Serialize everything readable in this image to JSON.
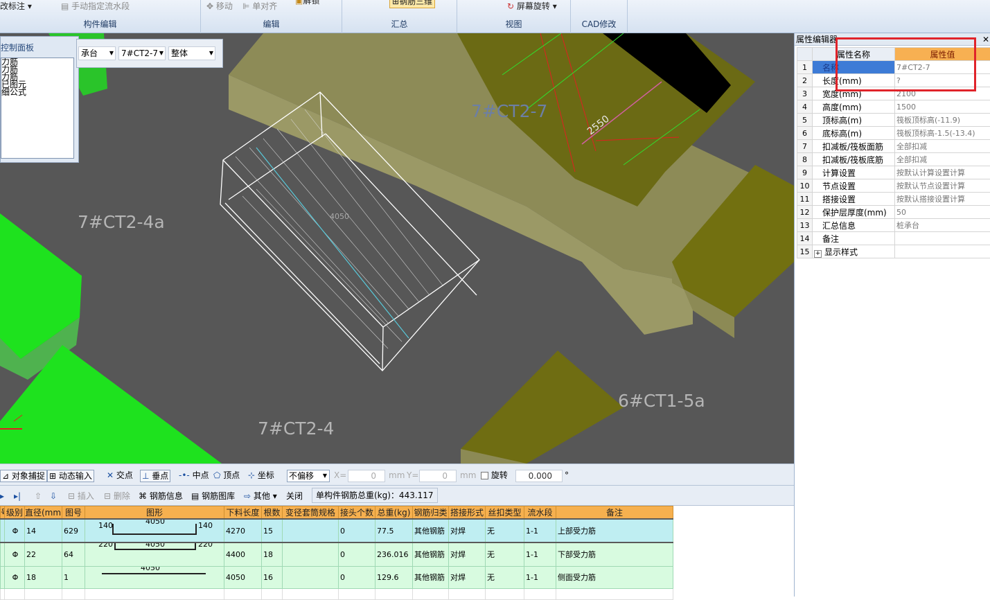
{
  "ribbon": {
    "mark_label": "改标注",
    "manual_flow": "手动指定流水段",
    "group_component": "构件编辑",
    "move": "移动",
    "align": "单对齐",
    "unlock": "解锁",
    "group_edit": "编辑",
    "rebar3d": "钢筋三维",
    "group_summary": "汇总",
    "screen_rotate": "屏幕旋转",
    "group_view": "视图",
    "group_cad": "CAD修改"
  },
  "control_panel": {
    "title": "控制面板",
    "items": [
      "力筋",
      "力筋",
      "力筋",
      "已图元",
      "细公式"
    ]
  },
  "selectors": {
    "type": "承台",
    "name": "7#CT2-7",
    "scope": "整体"
  },
  "viewport": {
    "labels": {
      "ct27": "7#CT2-7",
      "ct24a": "7#CT2-4a",
      "ct24": "7#CT2-4",
      "ct15a": "6#CT1-5a",
      "dim2550": "2550",
      "dim4050": "4050"
    }
  },
  "property_editor": {
    "title": "属性编辑器",
    "col_name": "属性名称",
    "col_value": "属性值",
    "rows": [
      {
        "n": "1",
        "name": "名称",
        "value": "7#CT2-7"
      },
      {
        "n": "2",
        "name": "长度(mm)",
        "value": "?"
      },
      {
        "n": "3",
        "name": "宽度(mm)",
        "value": "2100"
      },
      {
        "n": "4",
        "name": "高度(mm)",
        "value": "1500"
      },
      {
        "n": "5",
        "name": "顶标高(m)",
        "value": "筏板顶标高(-11.9)"
      },
      {
        "n": "6",
        "name": "底标高(m)",
        "value": "筏板顶标高-1.5(-13.4)"
      },
      {
        "n": "7",
        "name": "扣减板/筏板面筋",
        "value": "全部扣减"
      },
      {
        "n": "8",
        "name": "扣减板/筏板底筋",
        "value": "全部扣减"
      },
      {
        "n": "9",
        "name": "计算设置",
        "value": "按默认计算设置计算"
      },
      {
        "n": "10",
        "name": "节点设置",
        "value": "按默认节点设置计算"
      },
      {
        "n": "11",
        "name": "搭接设置",
        "value": "按默认搭接设置计算"
      },
      {
        "n": "12",
        "name": "保护层厚度(mm)",
        "value": "50"
      },
      {
        "n": "13",
        "name": "汇总信息",
        "value": "桩承台"
      },
      {
        "n": "14",
        "name": "备注",
        "value": ""
      },
      {
        "n": "15",
        "name": "显示样式",
        "value": ""
      }
    ]
  },
  "snap_bar": {
    "object_snap": "对象捕捉",
    "dynamic_input": "动态输入",
    "intersection": "交点",
    "perpendicular": "垂点",
    "midpoint": "中点",
    "vertex": "顶点",
    "coordinate": "坐标",
    "offset_mode": "不偏移",
    "x_label": "X=",
    "x_value": "0",
    "mm1": "mm",
    "y_label": "Y=",
    "y_value": "0",
    "mm2": "mm",
    "rotate_label": "旋转",
    "rotate_value": "0.000",
    "degree": "°"
  },
  "rebar_toolbar": {
    "insert": "插入",
    "delete": "删除",
    "rebar_info": "钢筋信息",
    "rebar_library": "钢筋图库",
    "other": "其他",
    "close": "关闭",
    "total_weight": "单构件钢筋总重(kg)：443.117"
  },
  "rebar_table": {
    "headers": [
      "号",
      "级别",
      "直径(mm)",
      "图号",
      "图形",
      "下料长度",
      "根数",
      "变径套筒规格",
      "接头个数",
      "总重(kg)",
      "钢筋归类",
      "搭接形式",
      "丝扣类型",
      "流水段",
      "备注"
    ],
    "rows": [
      {
        "grade": "Φ",
        "dia": "14",
        "fig": "629",
        "left": "140",
        "mid": "4050",
        "right": "140",
        "len": "4270",
        "count": "15",
        "sleeve": "",
        "joints": "0",
        "weight": "77.5",
        "category": "其他钢筋",
        "lap": "对焊",
        "thread": "无",
        "flow": "1-1",
        "note": "上部受力筋"
      },
      {
        "grade": "Φ",
        "dia": "22",
        "fig": "64",
        "left": "220",
        "mid": "4050",
        "right": "220",
        "len": "4400",
        "count": "18",
        "sleeve": "",
        "joints": "0",
        "weight": "236.016",
        "category": "其他钢筋",
        "lap": "对焊",
        "thread": "无",
        "flow": "1-1",
        "note": "下部受力筋"
      },
      {
        "grade": "Φ",
        "dia": "18",
        "fig": "1",
        "left": "",
        "mid": "4050",
        "right": "",
        "len": "4050",
        "count": "16",
        "sleeve": "",
        "joints": "0",
        "weight": "129.6",
        "category": "其他钢筋",
        "lap": "对焊",
        "thread": "无",
        "flow": "1-1",
        "note": "侧面受力筋"
      }
    ]
  }
}
